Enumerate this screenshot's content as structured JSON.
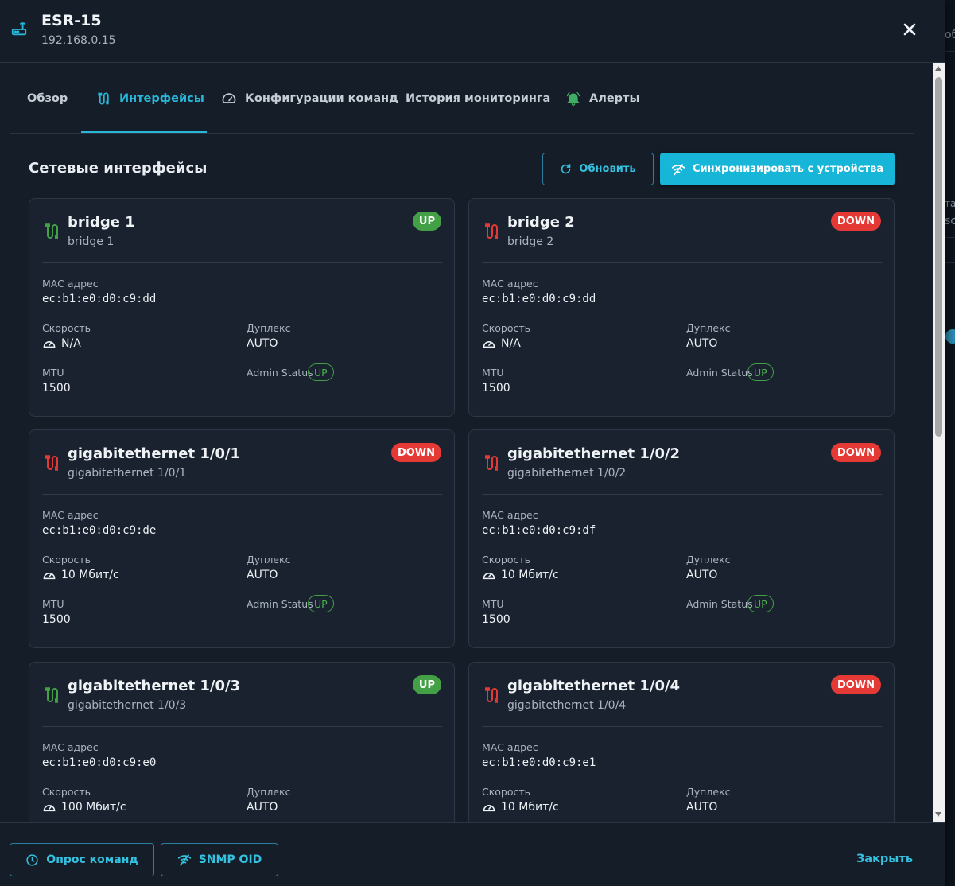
{
  "header": {
    "title": "ESR-15",
    "subtitle": "192.168.0.15"
  },
  "tabs": [
    {
      "label": "Обзор",
      "icon": ""
    },
    {
      "label": "Интерфейсы",
      "icon": "interface-icon"
    },
    {
      "label": "Конфигурации команд",
      "icon": "gauge-icon"
    },
    {
      "label": "История мониторинга",
      "icon": ""
    },
    {
      "label": "Алерты",
      "icon": "bell-icon"
    }
  ],
  "section": {
    "title": "Сетевые интерфейсы",
    "refresh_label": "Обновить",
    "sync_label": "Синхронизировать с устройства"
  },
  "labels": {
    "mac": "MAC адрес",
    "speed": "Скорость",
    "duplex": "Дуплекс",
    "mtu": "MTU",
    "admin_status": "Admin Status"
  },
  "interfaces": [
    {
      "name": "bridge 1",
      "desc": "bridge 1",
      "status": "UP",
      "mac": "ec:b1:e0:d0:c9:dd",
      "speed": "N/A",
      "duplex": "AUTO",
      "mtu": "1500",
      "admin": "UP"
    },
    {
      "name": "bridge 2",
      "desc": "bridge 2",
      "status": "DOWN",
      "mac": "ec:b1:e0:d0:c9:dd",
      "speed": "N/A",
      "duplex": "AUTO",
      "mtu": "1500",
      "admin": "UP"
    },
    {
      "name": "gigabitethernet 1/0/1",
      "desc": "gigabitethernet 1/0/1",
      "status": "DOWN",
      "mac": "ec:b1:e0:d0:c9:de",
      "speed": "10 Мбит/с",
      "duplex": "AUTO",
      "mtu": "1500",
      "admin": "UP"
    },
    {
      "name": "gigabitethernet 1/0/2",
      "desc": "gigabitethernet 1/0/2",
      "status": "DOWN",
      "mac": "ec:b1:e0:d0:c9:df",
      "speed": "10 Мбит/с",
      "duplex": "AUTO",
      "mtu": "1500",
      "admin": "UP"
    },
    {
      "name": "gigabitethernet 1/0/3",
      "desc": "gigabitethernet 1/0/3",
      "status": "UP",
      "mac": "ec:b1:e0:d0:c9:e0",
      "speed": "100 Мбит/с",
      "duplex": "AUTO"
    },
    {
      "name": "gigabitethernet 1/0/4",
      "desc": "gigabitethernet 1/0/4",
      "status": "DOWN",
      "mac": "ec:b1:e0:d0:c9:e1",
      "speed": "10 Мбит/с",
      "duplex": "AUTO"
    }
  ],
  "footer": {
    "poll_label": "Опрос команд",
    "snmp_label": "SNMP OID",
    "close_label": "Закрыть"
  },
  "background": {
    "frag1": "об",
    "frag2": "та",
    "frag3": "sc"
  },
  "colors": {
    "accent": "#17b6d8",
    "up": "#43a047",
    "down": "#e53935"
  }
}
